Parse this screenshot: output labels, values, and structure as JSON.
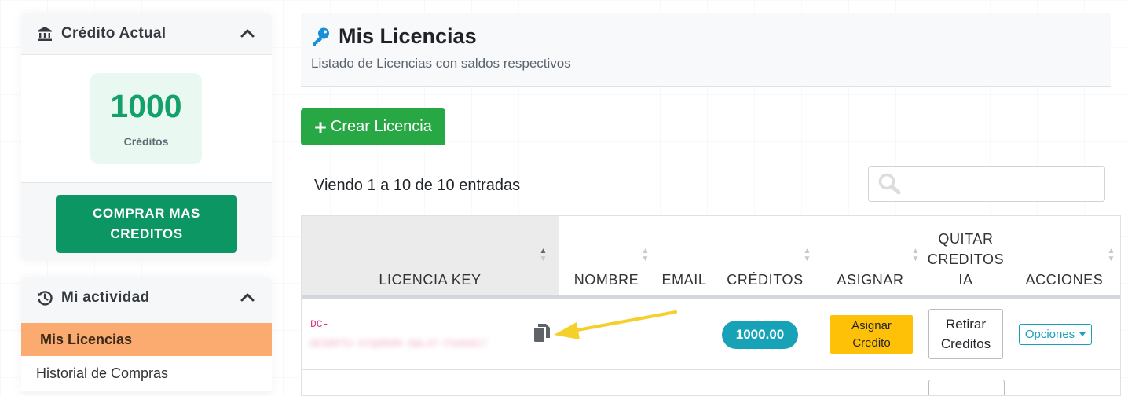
{
  "sidebar": {
    "credit_card": {
      "title": "Crédito Actual",
      "value": "1000",
      "label": "Créditos",
      "buy_button": "COMPRAR MAS CREDITOS"
    },
    "activity_card": {
      "title": "Mi actividad",
      "items": [
        {
          "label": "Mis Licencias",
          "active": true
        },
        {
          "label": "Historial de Compras",
          "active": false
        }
      ]
    }
  },
  "header": {
    "title": "Mis Licencias",
    "subtitle": "Listado de Licencias con saldos respectivos"
  },
  "toolbar": {
    "create_label": "Crear Licencia",
    "entries_text": "Viendo 1 a 10 de 10 entradas",
    "search_value": ""
  },
  "table": {
    "columns": [
      "LICENCIA KEY",
      "NOMBRE",
      "EMAIL",
      "CRÉDITOS",
      "ASIGNAR",
      "QUITAR CREDITOS IA",
      "ACCIONES"
    ],
    "rows": [
      {
        "key_prefix": "DC-",
        "key_rest": "9E5RPTU-5YQ0R8M-3WL4T-FSAG6C7",
        "nombre": "",
        "email": "",
        "creditos": "1000.00",
        "asignar": "Asignar Credito",
        "quitar": "Retirar Creditos",
        "acciones": "Opciones"
      }
    ]
  },
  "colors": {
    "accent_green": "#28a745",
    "buy_green": "#0b9664",
    "info": "#17a2b8",
    "warning": "#ffc107",
    "active_nav": "#fbab6f",
    "annotation_arrow": "#f5cf2a"
  },
  "icons": [
    "bank-icon",
    "chevron-up-icon",
    "history-icon",
    "key-icon",
    "plus-icon",
    "search-icon",
    "copy-icon",
    "sort-icon",
    "caret-down-icon",
    "annotation-arrow"
  ]
}
